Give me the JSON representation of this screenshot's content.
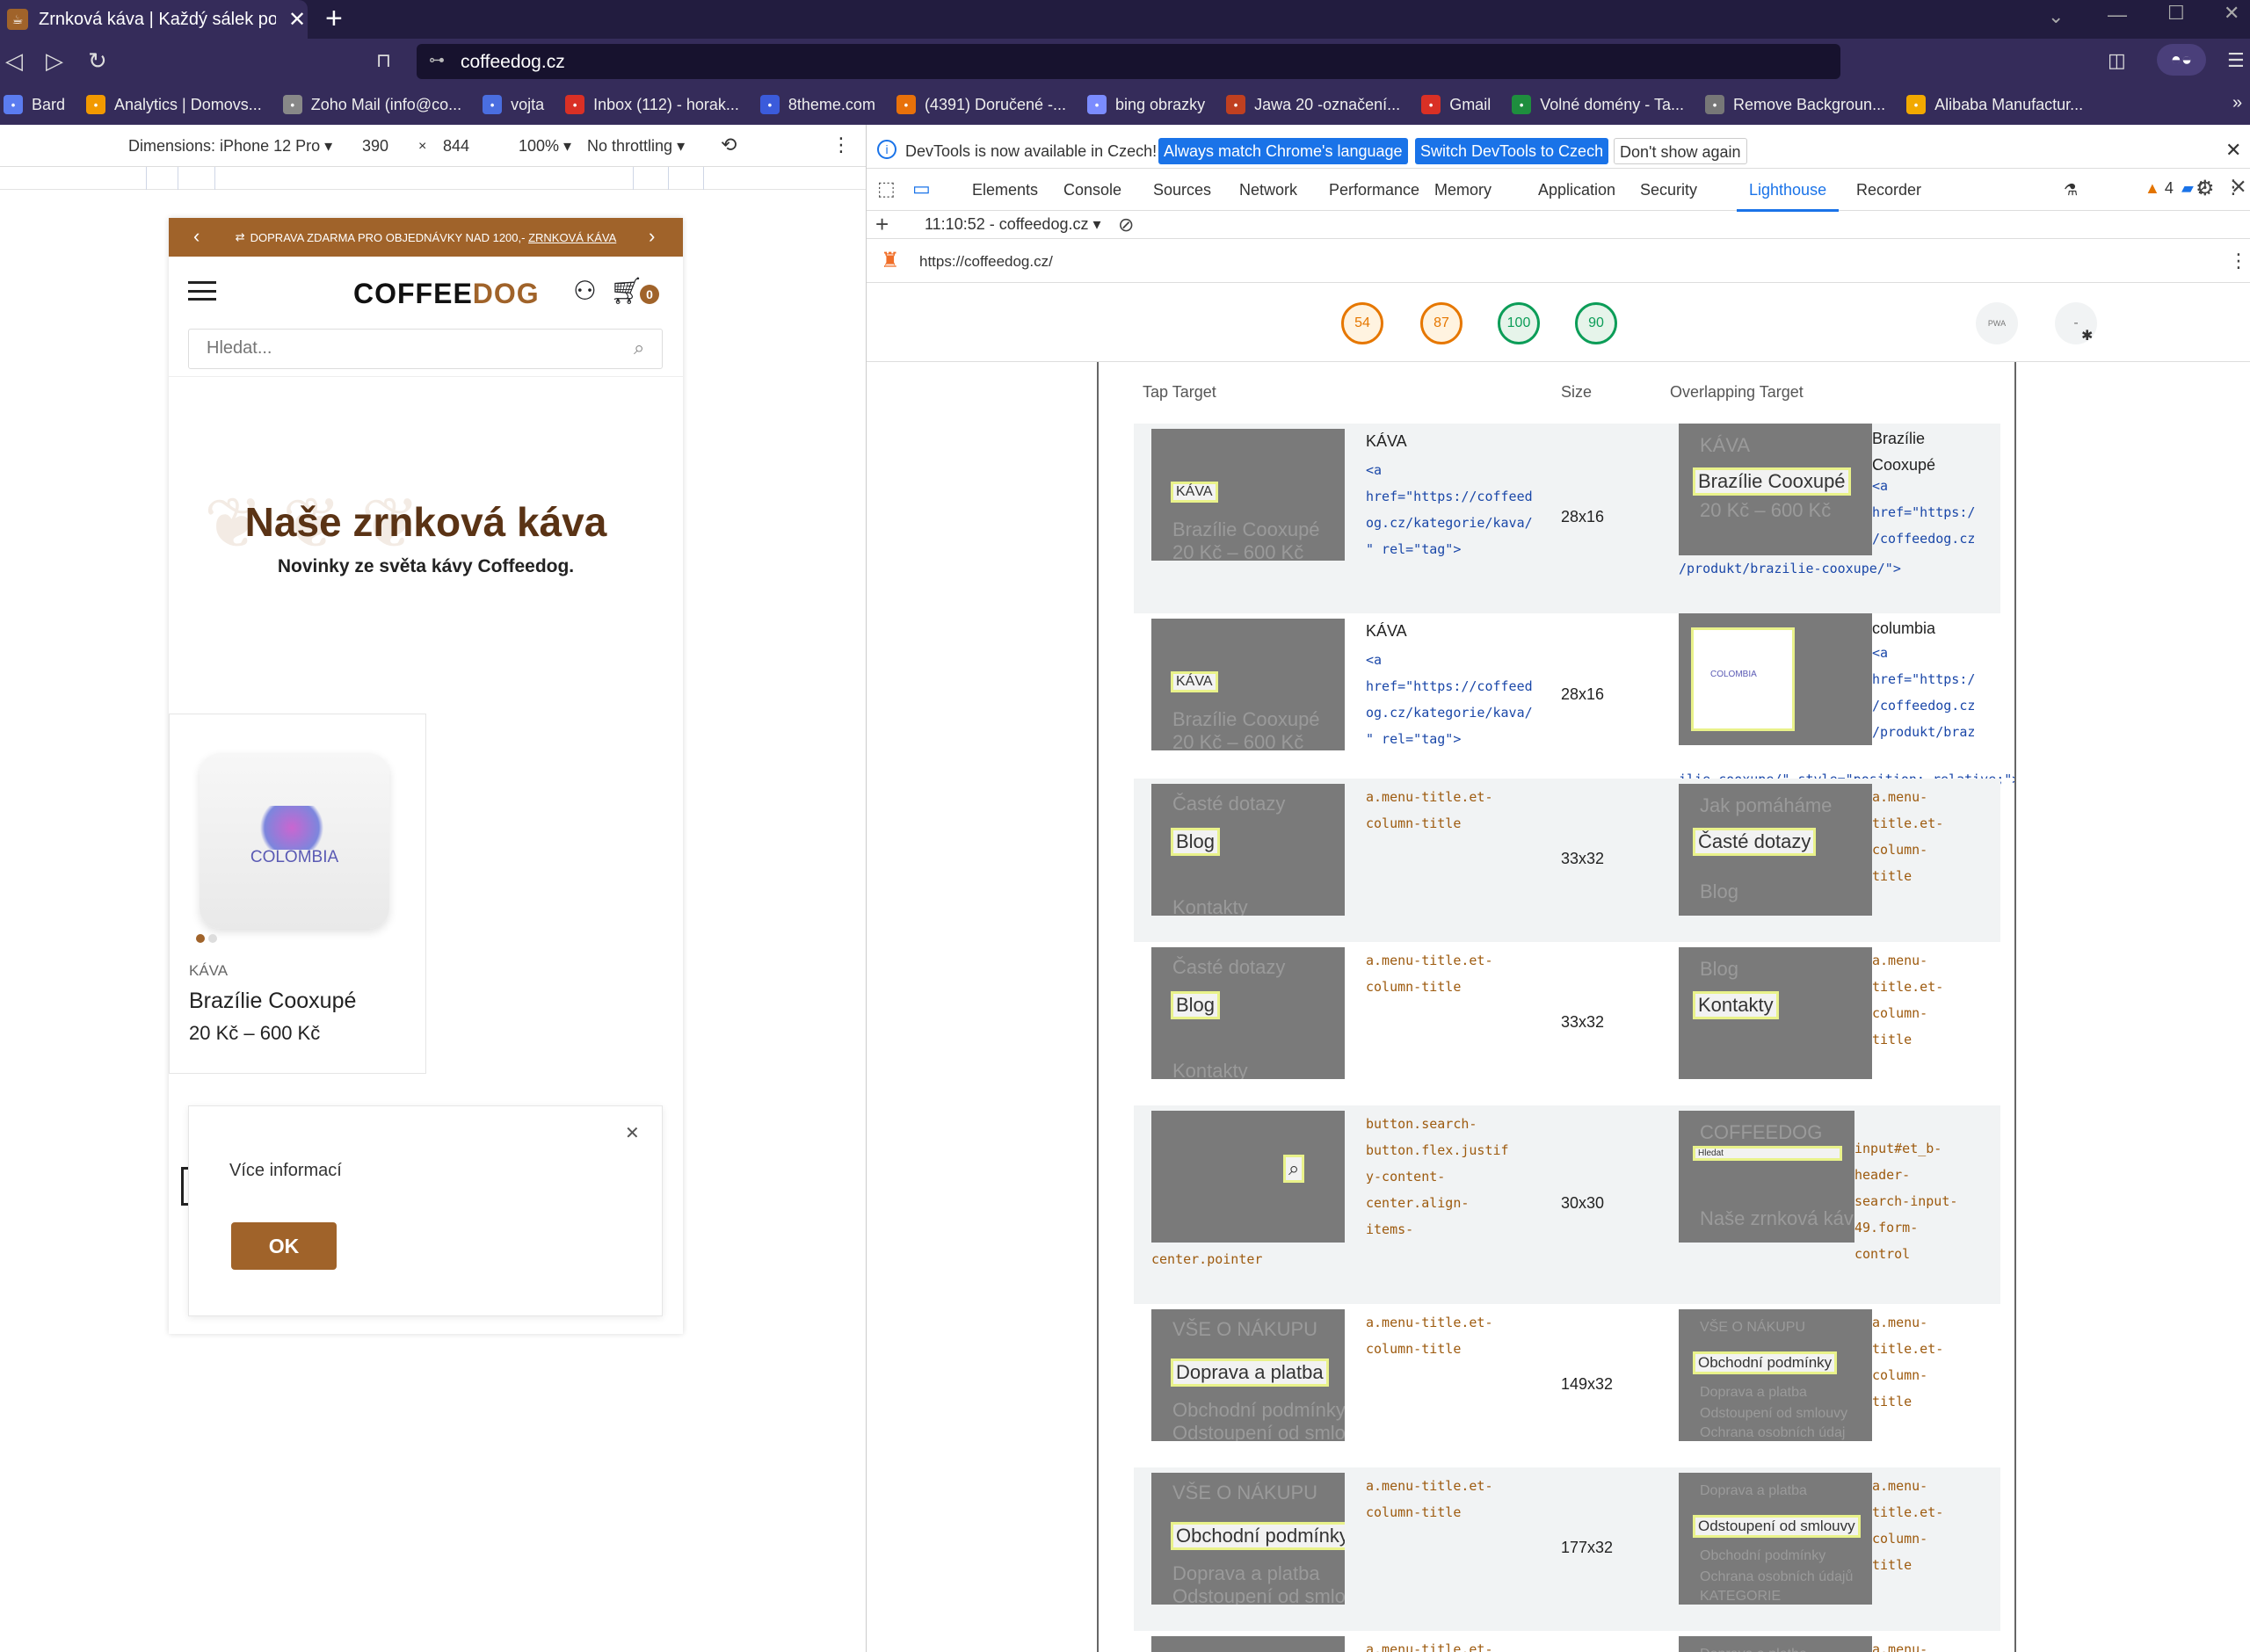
{
  "browser": {
    "tab_title": "Zrnková káva | Každý sálek podp",
    "url": "coffeedog.cz",
    "bookmarks": [
      {
        "label": "Bard",
        "color": "#5b7cf0"
      },
      {
        "label": "Analytics | Domovs...",
        "color": "#f29900"
      },
      {
        "label": "Zoho Mail (info@co...",
        "color": "#888888"
      },
      {
        "label": "vojta",
        "color": "#4a6ee0"
      },
      {
        "label": "Inbox (112) - horak...",
        "color": "#d93025"
      },
      {
        "label": "8theme.com",
        "color": "#3b5bdb"
      },
      {
        "label": "(4391) Doručené -...",
        "color": "#e8710a"
      },
      {
        "label": "bing obrazky",
        "color": "#7b8cff"
      },
      {
        "label": "Jawa 20 -označení...",
        "color": "#c04020"
      },
      {
        "label": "Gmail",
        "color": "#d93025"
      },
      {
        "label": "Volné domény - Ta...",
        "color": "#1e8e3e"
      },
      {
        "label": "Remove Backgroun...",
        "color": "#777777"
      },
      {
        "label": "Alibaba Manufactur...",
        "color": "#f2a900"
      }
    ]
  },
  "emulation": {
    "device": "Dimensions: iPhone 12 Pro",
    "width": "390",
    "height": "844",
    "zoom": "100%",
    "throttle": "No throttling"
  },
  "site": {
    "promo": "DOPRAVA ZDARMA PRO OBJEDNÁVKY NAD 1200,-",
    "promo_link": "ZRNKOVÁ KÁVA",
    "logo_a": "COFFEE",
    "logo_b": "DOG",
    "cart_count": "0",
    "search_placeholder": "Hledat...",
    "hero_title": "Naše zrnková káva",
    "hero_sub": "Novinky ze světa kávy Coffeedog.",
    "bag_label": "COLOMBIA",
    "product_cat": "KÁVA",
    "product_name": "Brazílie Cooxupé",
    "product_price": "20 Kč – 600 Kč",
    "cookie_text": "Více informací",
    "cookie_ok": "OK"
  },
  "devtools": {
    "info_text": "DevTools is now available in Czech!",
    "btn_match": "Always match Chrome's language",
    "btn_switch": "Switch DevTools to Czech",
    "btn_dont": "Don't show again",
    "tabs": [
      "Elements",
      "Console",
      "Sources",
      "Network",
      "Performance",
      "Memory",
      "Application",
      "Security",
      "Lighthouse",
      "Recorder"
    ],
    "warn_count": "4",
    "msg_count": "2",
    "report_sel": "11:10:52 - coffeedog.cz",
    "lh_url": "https://coffeedog.cz/",
    "scores": [
      {
        "value": "54",
        "color": "#e67700",
        "bg": "#fff3e0"
      },
      {
        "value": "87",
        "color": "#e67700",
        "bg": "#fff3e0"
      },
      {
        "value": "100",
        "color": "#0c9d58",
        "bg": "#e6f4ea"
      },
      {
        "value": "90",
        "color": "#0c9d58",
        "bg": "#e6f4ea"
      }
    ],
    "pwa_label": "PWA",
    "ext_label": "-",
    "table_headers": {
      "target": "Tap Target",
      "size": "Size",
      "overlap": "Overlapping Target"
    }
  },
  "rows": [
    {
      "t_hl": "KÁVA",
      "t_l1": "",
      "t_l2": "Brazílie Cooxupé",
      "t_l3": "20 Kč – 600 Kč",
      "label": "KÁVA",
      "code": "<a\nhref=\"https://coffeed\nog.cz/kategorie/kava/\n\" rel=\"tag\">",
      "size": "28x16",
      "o_hl": "Brazílie Cooxupé",
      "o_l1": "KÁVA",
      "o_l2": "20 Kč – 600 Kč",
      "o_label": "Brazílie\nCooxupé",
      "o_code": "<a\nhref=\"https:/\n/coffeedog.cz",
      "o_tail": "/produkt/brazilie-cooxupe/\">"
    },
    {
      "t_hl": "KÁVA",
      "t_l1": "",
      "t_l2": "Brazílie Cooxupé",
      "t_l3": "20 Kč – 600 Kč",
      "label": "KÁVA",
      "code": "<a\nhref=\"https://coffeed\nog.cz/kategorie/kava/\n\" rel=\"tag\">",
      "size": "28x16",
      "o_hl": "COLOMBIA",
      "o_l1": "",
      "o_l2": "",
      "o_label": "columbia",
      "o_code": "<a\nhref=\"https:/\n/coffeedog.cz\n/produkt/braz",
      "o_tail": "ilie-cooxupe/\" style=\"position: relative;\">"
    },
    {
      "t_hl": "Blog",
      "t_l1": "Časté dotazy",
      "t_l2": "",
      "t_l3": "Kontakty",
      "label": "",
      "code": "a.menu-title.et-\ncolumn-title",
      "size": "33x32",
      "o_hl": "Časté dotazy",
      "o_l1": "Jak pomáháme",
      "o_l2": "",
      "o_l3": "Blog",
      "o_label": "",
      "o_code": "a.menu-\ntitle.et-\ncolumn-\ntitle",
      "o_tail": ""
    },
    {
      "t_hl": "Blog",
      "t_l1": "Časté dotazy",
      "t_l2": "",
      "t_l3": "Kontakty",
      "label": "",
      "code": "a.menu-title.et-\ncolumn-title",
      "size": "33x32",
      "o_hl": "Kontakty",
      "o_l1": "Blog",
      "o_l2": "",
      "o_l3": "",
      "o_label": "",
      "o_code": "a.menu-\ntitle.et-\ncolumn-\ntitle",
      "o_tail": ""
    },
    {
      "t_hl": "⌕",
      "t_l1": "",
      "t_l2": "",
      "t_l3": "",
      "label": "",
      "code": "button.search-\nbutton.flex.justif\ny-content-\ncenter.align-\nitems-",
      "code_tail": "center.pointer",
      "size": "30x30",
      "o_hl": "Hledat",
      "o_l1": "COFFEEDOG",
      "o_l2": "",
      "o_l3": "Naše zrnková káva",
      "o_label": "",
      "o_code": "input#et_b-\nheader-\nsearch-input-\n49.form-\ncontrol",
      "o_tail": ""
    },
    {
      "t_hl": "Doprava a platba",
      "t_l1": "VŠE O NÁKUPU",
      "t_l2": "Obchodní podmínky",
      "t_l3": "Odstoupení od smlo",
      "label": "",
      "code": "a.menu-title.et-\ncolumn-title",
      "size": "149x32",
      "o_hl": "Obchodní podmínky",
      "o_l1": "VŠE O NÁKUPU",
      "o_l2": "Doprava a platba",
      "o_l3": "Odstoupení od smlouvy",
      "o_l4": "Ochrana osobních údaj",
      "o_label": "",
      "o_code": "a.menu-\ntitle.et-\ncolumn-\ntitle",
      "o_tail": ""
    },
    {
      "t_hl": "Obchodní podmínky",
      "t_l1": "VŠE O NÁKUPU",
      "t_l2": "Doprava a platba",
      "t_l3": "Odstoupení od smlouv",
      "t_l4": "Ochrana osobních údaj",
      "label": "",
      "code": "a.menu-title.et-\ncolumn-title",
      "size": "177x32",
      "o_hl": "Odstoupení od smlouvy",
      "o_l1": "Doprava a platba",
      "o_l2": "Obchodní podmínky",
      "o_l3": "Ochrana osobních údajů",
      "o_l4": "KATEGORIE",
      "o_label": "",
      "o_code": "a.menu-\ntitle.et-\ncolumn-\ntitle",
      "o_tail": ""
    },
    {
      "t_hl": "",
      "t_l1": "",
      "t_l2": "",
      "t_l3": "",
      "label": "",
      "code": "a.menu-title.et-",
      "size": "",
      "o_hl": "",
      "o_l1": "Doprava a platba",
      "o_l2": "",
      "o_l3": "",
      "o_label": "",
      "o_code": "a.menu-",
      "o_tail": ""
    }
  ]
}
